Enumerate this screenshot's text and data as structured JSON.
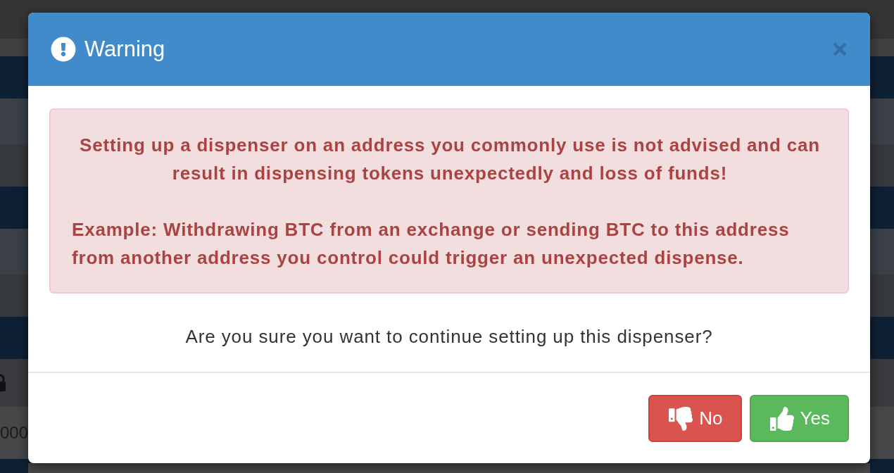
{
  "background_page": {
    "amount_fragment": "000"
  },
  "dialog": {
    "title": "Warning",
    "alert": {
      "lead": "Setting up a dispenser on an address you commonly use is not advised and can result in dispensing tokens unexpectedly and loss of funds!",
      "example": "Example: Withdrawing BTC from an exchange or sending BTC to this address from another address you control could trigger an unexpected dispense."
    },
    "question": "Are you sure you want to continue setting up this dispenser?",
    "buttons": [
      {
        "label": "No",
        "kind": "decline"
      },
      {
        "label": "Yes",
        "kind": "confirm"
      }
    ]
  }
}
